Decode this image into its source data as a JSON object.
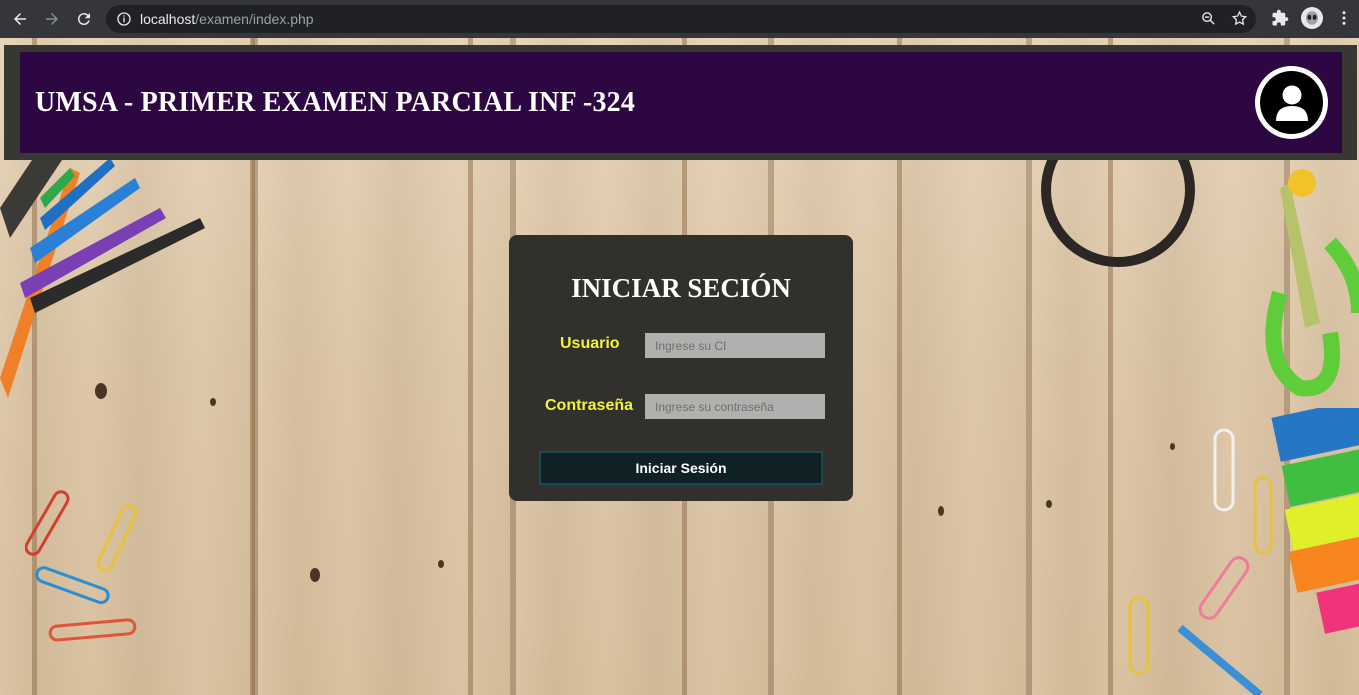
{
  "browser": {
    "url_host": "localhost",
    "url_path": "/examen/index.php"
  },
  "header": {
    "title": "UMSA - PRIMER EXAMEN PARCIAL INF -324"
  },
  "login": {
    "title": "INICIAR SECIÓN",
    "user_label": "Usuario",
    "user_placeholder": "Ingrese su CI",
    "password_label": "Contraseña",
    "password_placeholder": "Ingrese su contraseña",
    "submit_label": "Iniciar Sesión"
  },
  "colors": {
    "header_bg": "#2d0742",
    "card_bg": "#32302d",
    "label_yellow": "#f2f23c",
    "button_bg": "#0f2125"
  }
}
